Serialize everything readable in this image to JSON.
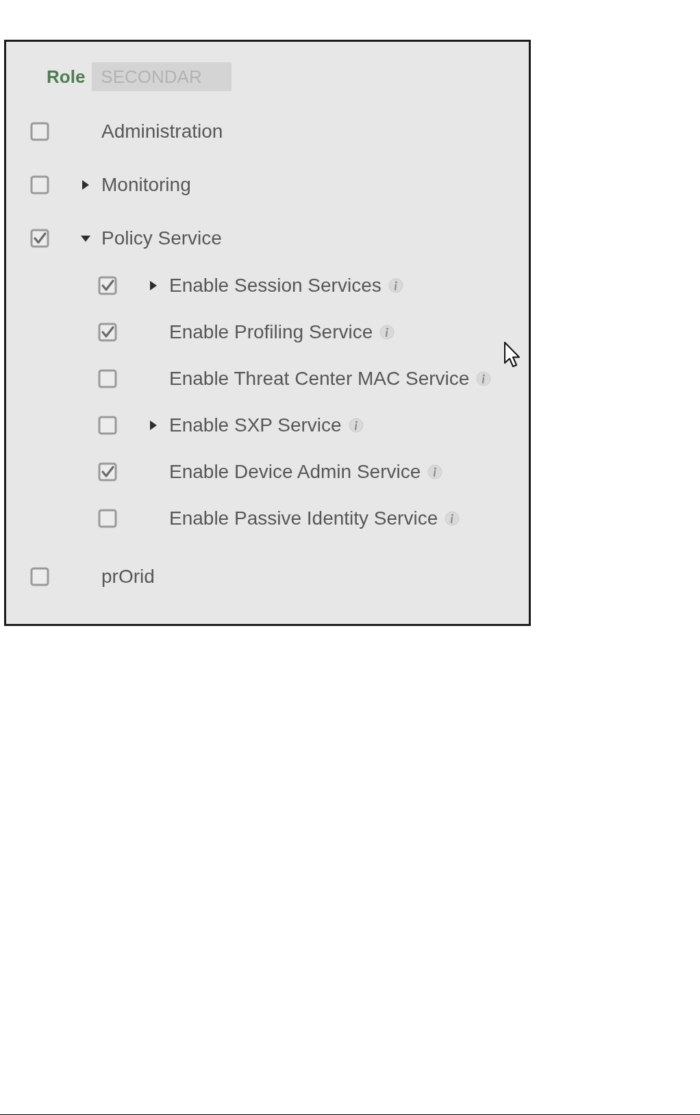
{
  "role": {
    "label": "Role",
    "value": "SECONDAR",
    "disabled": true
  },
  "services": [
    {
      "label": "Administration",
      "kind": "plain",
      "checked": false,
      "info": false
    },
    {
      "label": "Monitoring",
      "kind": "expander",
      "expanded": false,
      "checked": false,
      "info": false
    },
    {
      "label": "Policy Service",
      "kind": "expander",
      "expanded": true,
      "checked": true,
      "info": false,
      "children": [
        {
          "label": "Enable Session Services",
          "kind": "expander",
          "expanded": false,
          "checked": true,
          "info": true
        },
        {
          "label": "Enable Profiling Service",
          "kind": "plain",
          "checked": true,
          "info": true
        },
        {
          "label": "Enable Threat Center MAC Service",
          "kind": "plain",
          "checked": false,
          "info": true
        },
        {
          "label": "Enable SXP Service",
          "kind": "expander",
          "expanded": false,
          "checked": false,
          "info": true
        },
        {
          "label": "Enable Device Admin Service",
          "kind": "plain",
          "checked": true,
          "info": true
        },
        {
          "label": "Enable Passive Identity Service",
          "kind": "plain",
          "checked": false,
          "info": true
        }
      ]
    },
    {
      "label": "prOrid",
      "kind": "plain",
      "checked": false,
      "info": false
    }
  ]
}
